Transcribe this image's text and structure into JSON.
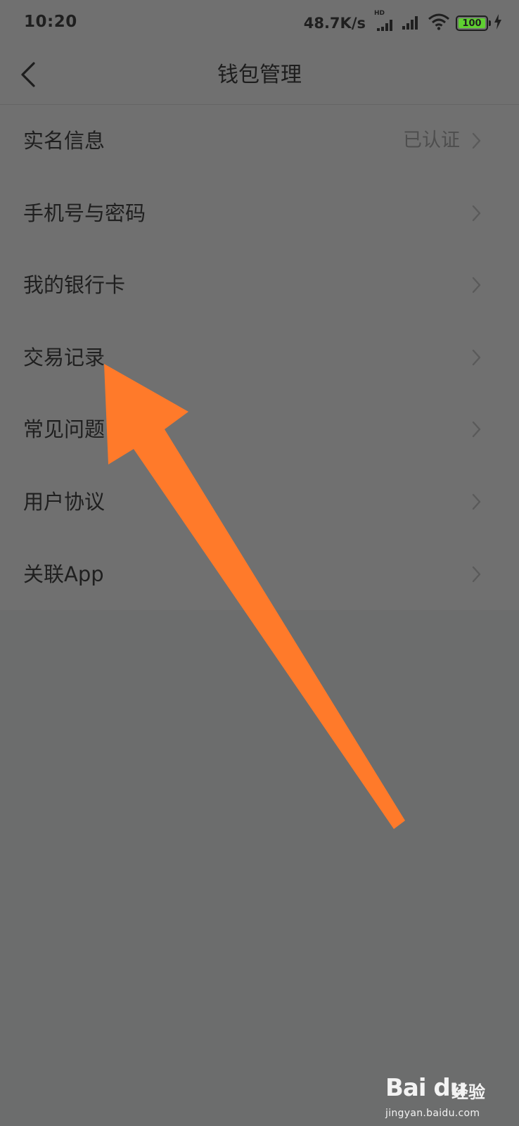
{
  "status_bar": {
    "time": "10:20",
    "net_speed": "48.7K/s",
    "hd_label": "HD",
    "battery_level": "100",
    "battery_color": "#5fd031"
  },
  "header": {
    "title": "钱包管理",
    "back_icon": "chevron-left-icon"
  },
  "menu": {
    "items": [
      {
        "label": "实名信息",
        "value": "已认证"
      },
      {
        "label": "手机号与密码",
        "value": ""
      },
      {
        "label": "我的银行卡",
        "value": ""
      },
      {
        "label": "交易记录",
        "value": ""
      },
      {
        "label": "常见问题",
        "value": ""
      },
      {
        "label": "用户协议",
        "value": ""
      },
      {
        "label": "关联App",
        "value": ""
      }
    ],
    "chevron_icon": "chevron-right-icon"
  },
  "annotation": {
    "arrow_color": "#ff7a2a"
  },
  "watermark": {
    "logo": "Bai du",
    "brand": "经验",
    "url": "jingyan.baidu.com"
  }
}
